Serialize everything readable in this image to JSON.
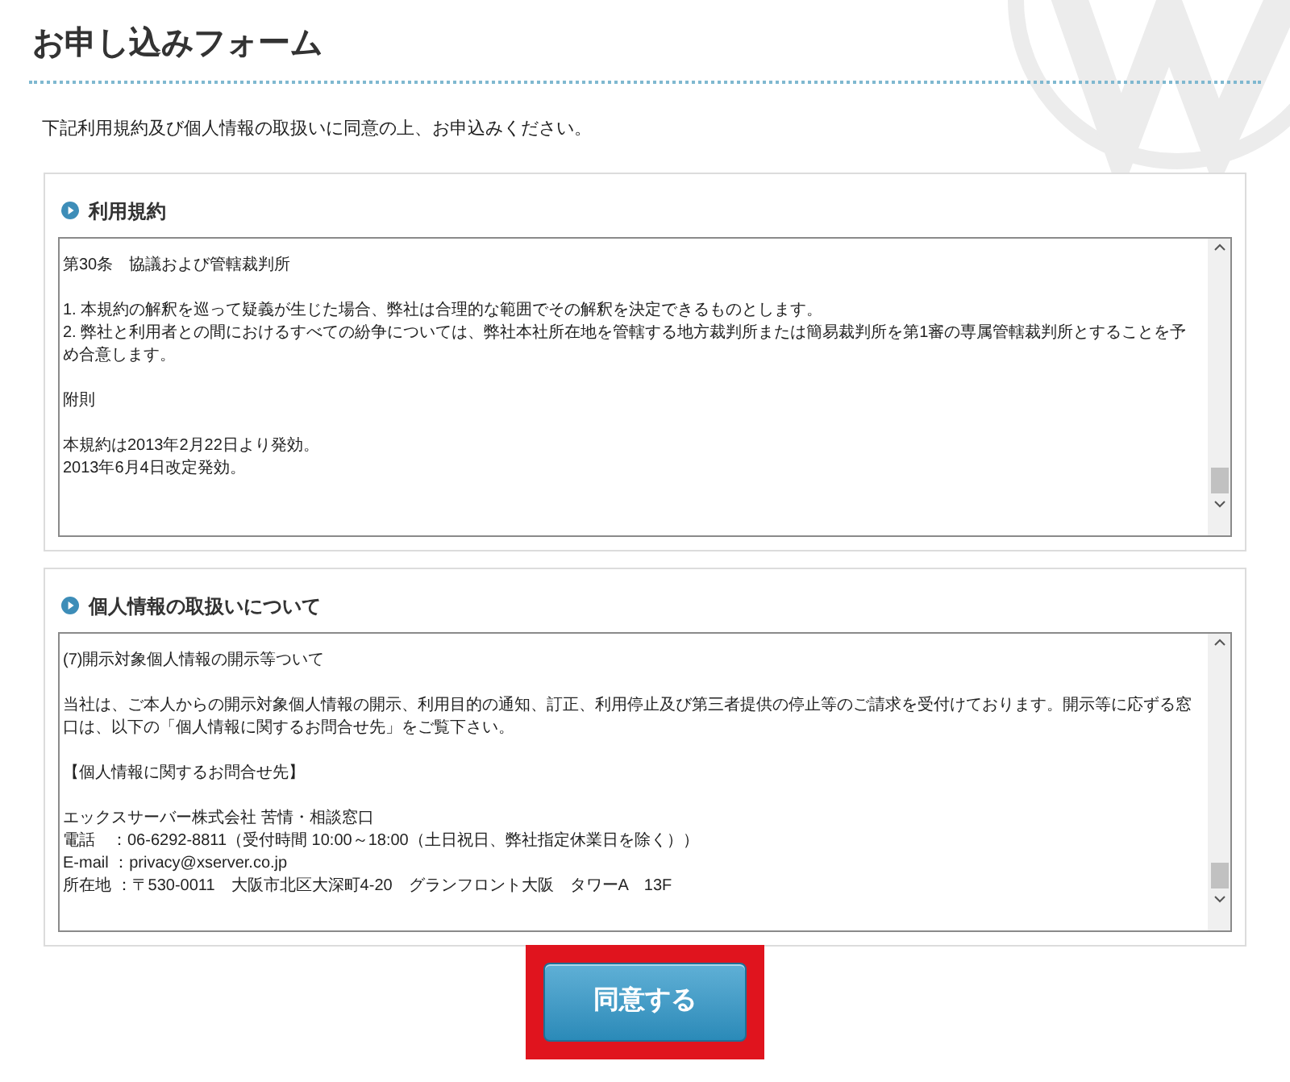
{
  "page": {
    "title": "お申し込みフォーム",
    "intro": "下記利用規約及び個人情報の取扱いに同意の上、お申込みください。"
  },
  "sections": [
    {
      "heading": "利用規約",
      "blocks": [
        [
          "第30条　協議および管轄裁判所"
        ],
        [
          "1. 本規約の解釈を巡って疑義が生じた場合、弊社は合理的な範囲でその解釈を決定できるものとします。",
          "2. 弊社と利用者との間におけるすべての紛争については、弊社本社所在地を管轄する地方裁判所または簡易裁判所を第1審の専属管轄裁判所とすることを予め合意します。"
        ],
        [
          "附則"
        ],
        [
          "本規約は2013年2月22日より発効。",
          "2013年6月4日改定発効。"
        ]
      ]
    },
    {
      "heading": "個人情報の取扱いについて",
      "blocks": [
        [
          "(7)開示対象個人情報の開示等ついて"
        ],
        [
          "当社は、ご本人からの開示対象個人情報の開示、利用目的の通知、訂正、利用停止及び第三者提供の停止等のご請求を受付けております。開示等に応ずる窓口は、以下の「個人情報に関するお問合せ先」をご覧下さい。"
        ],
        [
          "【個人情報に関するお問合せ先】"
        ],
        [
          "エックスサーバー株式会社 苦情・相談窓口",
          "電話　：06-6292-8811（受付時間 10:00～18:00（土日祝日、弊社指定休業日を除く））",
          "E-mail ：privacy@xserver.co.jp",
          "所在地 ：〒530-0011　大阪市北区大深町4-20　グランフロント大阪　タワーA　13F"
        ]
      ]
    }
  ],
  "agree_button": {
    "label": "同意する"
  }
}
